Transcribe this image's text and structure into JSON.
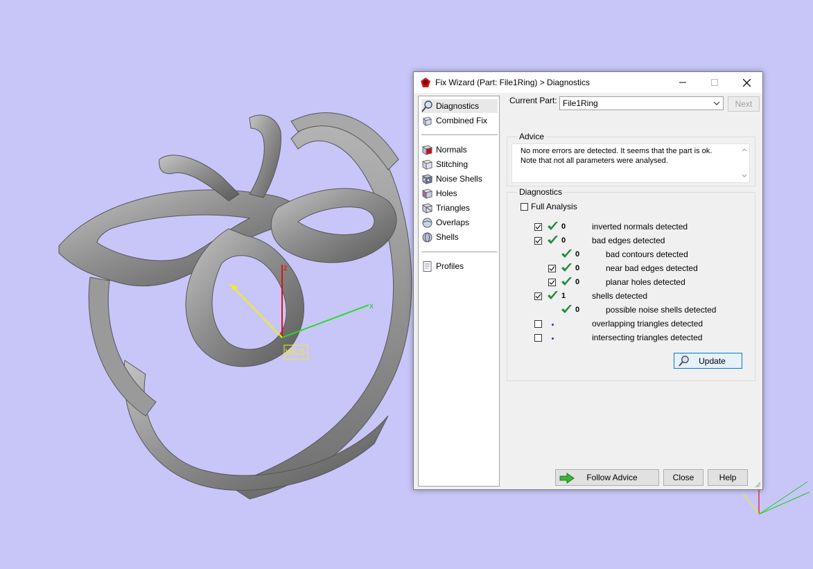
{
  "viewport": {
    "axis_x_label": "x",
    "axis_z_label": "z",
    "wcs_label": "WCS"
  },
  "dialog": {
    "title": "Fix Wizard (Part: File1Ring) > Diagnostics",
    "nav": {
      "top": [
        {
          "label": "Diagnostics",
          "icon": "magnifier-icon"
        },
        {
          "label": "Combined Fix",
          "icon": "cube-icon"
        }
      ],
      "fixes": [
        {
          "label": "Normals",
          "icon": "normals-icon"
        },
        {
          "label": "Stitching",
          "icon": "stitching-icon"
        },
        {
          "label": "Noise Shells",
          "icon": "noise-shells-icon"
        },
        {
          "label": "Holes",
          "icon": "holes-icon"
        },
        {
          "label": "Triangles",
          "icon": "triangles-icon"
        },
        {
          "label": "Overlaps",
          "icon": "overlaps-icon"
        },
        {
          "label": "Shells",
          "icon": "shells-icon"
        }
      ],
      "bottom": [
        {
          "label": "Profiles",
          "icon": "profiles-icon"
        }
      ]
    },
    "current_part": {
      "label": "Current Part:",
      "value": "File1Ring"
    },
    "next_label": "Next",
    "advice": {
      "heading": "Advice",
      "line1": "No more errors are detected. It seems that the part is ok.",
      "line2": "Note that not all parameters were analysed."
    },
    "diagnostics": {
      "heading": "Diagnostics",
      "full_analysis_label": "Full Analysis",
      "rows": [
        {
          "checked": true,
          "status": "ok",
          "count": "0",
          "text": "inverted normals detected"
        },
        {
          "checked": true,
          "status": "ok",
          "count": "0",
          "text": "bad edges detected"
        },
        {
          "checked": null,
          "status": "ok",
          "count": "0",
          "text": "bad contours detected"
        },
        {
          "checked": true,
          "status": "ok",
          "count": "0",
          "text": "near bad edges detected"
        },
        {
          "checked": true,
          "status": "ok",
          "count": "0",
          "text": "planar holes detected"
        },
        {
          "checked": true,
          "status": "ok",
          "count": "1",
          "text": "shells detected"
        },
        {
          "checked": null,
          "status": "ok",
          "count": "0",
          "text": "possible noise shells detected"
        },
        {
          "checked": false,
          "status": "none",
          "count": "",
          "text": "overlapping triangles detected"
        },
        {
          "checked": false,
          "status": "none",
          "count": "",
          "text": "intersecting triangles detected"
        }
      ],
      "update_label": "Update"
    },
    "footer": {
      "follow_advice_label": "Follow Advice",
      "close_label": "Close",
      "help_label": "Help"
    }
  }
}
